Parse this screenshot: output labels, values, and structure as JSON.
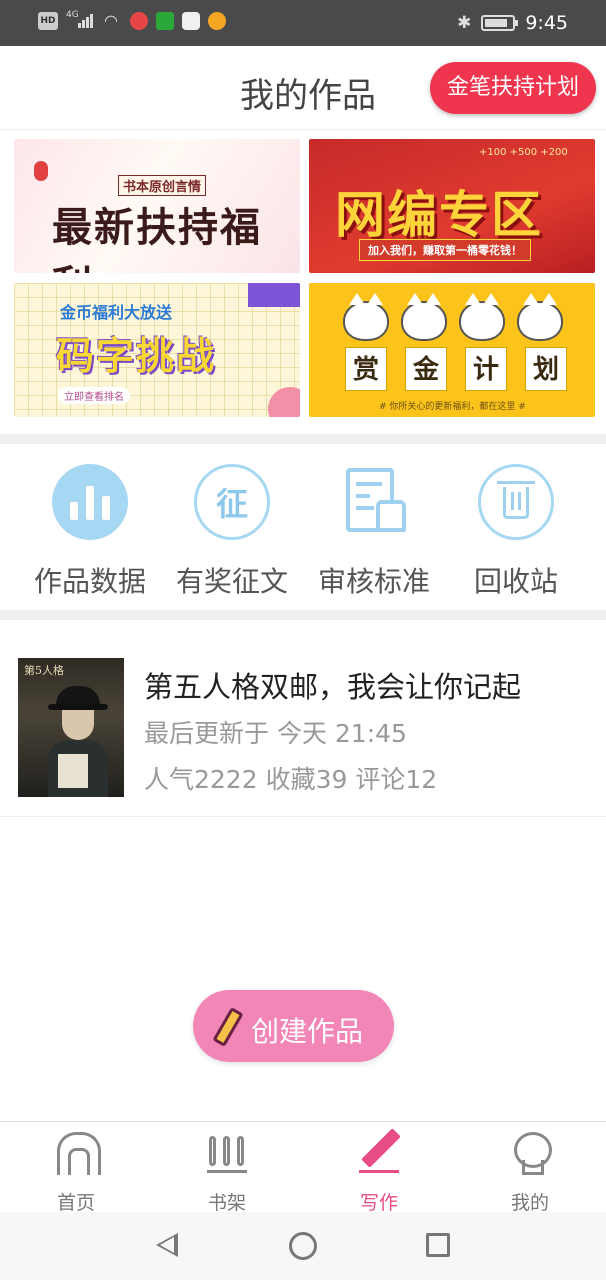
{
  "status_bar": {
    "left_icons": [
      "hd-icon",
      "signal-icon",
      "wifi-icon",
      "notification-icon",
      "app-icon",
      "camera-icon",
      "weibo-icon"
    ],
    "hd_label": "HD",
    "network_label": "4G",
    "time": "9:45"
  },
  "header": {
    "title": "我的作品",
    "support_button": "金笔扶持计划"
  },
  "banners": [
    {
      "name": "banner-support",
      "line1": "书本原创言情",
      "line2": "最新扶持福利"
    },
    {
      "name": "banner-editor-zone",
      "line1": "网编专区",
      "line2": "加入我们，赚取第一桶零花钱！",
      "deco": "+100 +500 +200"
    },
    {
      "name": "banner-typing-challenge",
      "line1": "金币福利大放送",
      "line2": "码字挑战",
      "line3": "立即查看排名"
    },
    {
      "name": "banner-bounty-plan",
      "chars": [
        "赏",
        "金",
        "计",
        "划"
      ],
      "line2": "# 你所关心的更新福利，都在这里 #"
    }
  ],
  "menu": {
    "items": [
      {
        "label": "作品数据",
        "icon": "chart-icon"
      },
      {
        "label": "有奖征文",
        "icon": "contest-icon",
        "glyph": "征"
      },
      {
        "label": "审核标准",
        "icon": "review-doc-icon"
      },
      {
        "label": "回收站",
        "icon": "trash-icon"
      }
    ]
  },
  "work": {
    "cover_title": "第5人格",
    "title": "第五人格双邮，我会让你记起",
    "updated": "最后更新于 今天 21:45",
    "stats": "人气2222  收藏39  评论12"
  },
  "create_button": {
    "label": "创建作品"
  },
  "tabbar": {
    "items": [
      {
        "label": "首页",
        "icon": "home-icon",
        "active": false
      },
      {
        "label": "书架",
        "icon": "bookshelf-icon",
        "active": false
      },
      {
        "label": "写作",
        "icon": "pen-icon",
        "active": true
      },
      {
        "label": "我的",
        "icon": "profile-icon",
        "active": false
      }
    ]
  },
  "colors": {
    "accent_red": "#f0364f",
    "accent_pink": "#e84d88",
    "create_pink": "#f286b6",
    "menu_blue": "#a6d8f3"
  }
}
